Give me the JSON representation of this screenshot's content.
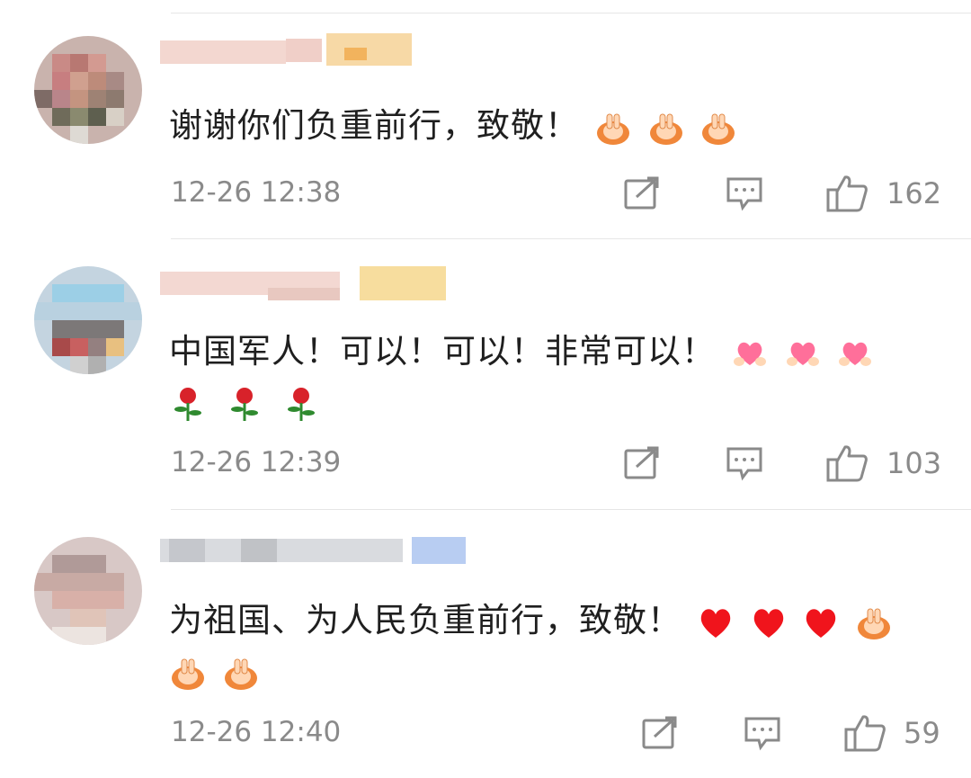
{
  "comments": [
    {
      "text": "谢谢你们负重前行，致敬！",
      "emojis": [
        "clap-hands",
        "clap-hands",
        "clap-hands"
      ],
      "time": "12-26 12:38",
      "likes": "162"
    },
    {
      "text": "中国军人！可以！可以！非常可以！",
      "emojis": [
        "heart-hands",
        "heart-hands",
        "heart-hands"
      ],
      "emojis2": [
        "rose",
        "rose",
        "rose"
      ],
      "time": "12-26 12:39",
      "likes": "103"
    },
    {
      "text": "为祖国、为人民负重前行，致敬！",
      "emojis": [
        "red-heart",
        "red-heart",
        "red-heart",
        "clap-hands"
      ],
      "emojis2": [
        "clap-hands",
        "clap-hands"
      ],
      "time": "12-26 12:40",
      "likes": "59"
    }
  ],
  "colors": {
    "text": "#1f1f1f",
    "meta": "#8a8a8a",
    "icon": "#8a8a8a",
    "divider": "#e6e6e6"
  }
}
